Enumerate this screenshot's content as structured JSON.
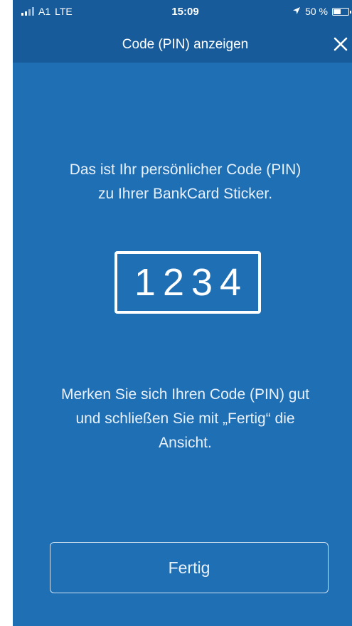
{
  "status_bar": {
    "carrier": "A1",
    "network": "LTE",
    "time": "15:09",
    "location_icon": "location-arrow-icon",
    "battery_percent_label": "50 %",
    "battery_level": 0.5
  },
  "nav": {
    "title": "Code (PIN) anzeigen",
    "close_icon": "close-icon"
  },
  "main": {
    "intro_line1": "Das ist Ihr persönlicher Code (PIN)",
    "intro_line2": "zu Ihrer BankCard Sticker.",
    "pin": "1234",
    "hint_line1": "Merken Sie sich Ihren Code (PIN) gut",
    "hint_line2": "und schließen Sie mit „Fertig“ die",
    "hint_line3": "Ansicht."
  },
  "actions": {
    "done_label": "Fertig"
  },
  "colors": {
    "background": "#1f6fb5",
    "header": "#175b9b",
    "text": "#ffffff"
  }
}
